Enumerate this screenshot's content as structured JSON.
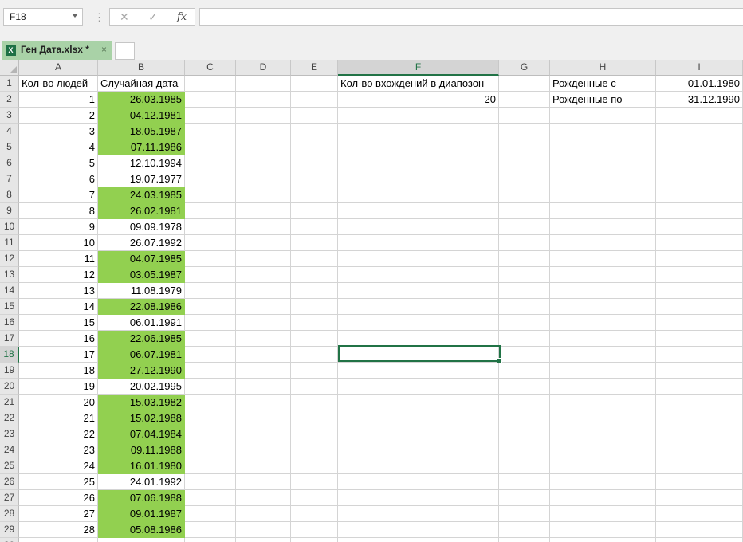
{
  "formula_bar": {
    "name_box": "F18",
    "cancel_icon": "✕",
    "enter_icon": "✓",
    "fx_label": "fx",
    "formula": ""
  },
  "tabs": [
    {
      "label": "Ген Дата.xlsx *",
      "close_icon": "×",
      "file_icon": "X"
    }
  ],
  "columns": [
    {
      "letter": "A",
      "width": 99
    },
    {
      "letter": "B",
      "width": 109
    },
    {
      "letter": "C",
      "width": 64
    },
    {
      "letter": "D",
      "width": 69
    },
    {
      "letter": "E",
      "width": 59
    },
    {
      "letter": "F",
      "width": 202
    },
    {
      "letter": "G",
      "width": 64
    },
    {
      "letter": "H",
      "width": 133
    },
    {
      "letter": "I",
      "width": 109
    }
  ],
  "selected": {
    "cell": "F18",
    "row": 18,
    "col": "F"
  },
  "header_row": {
    "A": "Кол-во людей",
    "B": "Случайная дата",
    "F": "Кол-во вхождений в диапозон",
    "H": "Рожденные с",
    "I": "01.01.1980"
  },
  "row2": {
    "F": "20",
    "H": "Рожденные по",
    "I": "31.12.1990"
  },
  "data_rows": [
    {
      "row": 2,
      "n": "1",
      "date": "26.03.1985",
      "in_range": true
    },
    {
      "row": 3,
      "n": "2",
      "date": "04.12.1981",
      "in_range": true
    },
    {
      "row": 4,
      "n": "3",
      "date": "18.05.1987",
      "in_range": true
    },
    {
      "row": 5,
      "n": "4",
      "date": "07.11.1986",
      "in_range": true
    },
    {
      "row": 6,
      "n": "5",
      "date": "12.10.1994",
      "in_range": false
    },
    {
      "row": 7,
      "n": "6",
      "date": "19.07.1977",
      "in_range": false
    },
    {
      "row": 8,
      "n": "7",
      "date": "24.03.1985",
      "in_range": true
    },
    {
      "row": 9,
      "n": "8",
      "date": "26.02.1981",
      "in_range": true
    },
    {
      "row": 10,
      "n": "9",
      "date": "09.09.1978",
      "in_range": false
    },
    {
      "row": 11,
      "n": "10",
      "date": "26.07.1992",
      "in_range": false
    },
    {
      "row": 12,
      "n": "11",
      "date": "04.07.1985",
      "in_range": true
    },
    {
      "row": 13,
      "n": "12",
      "date": "03.05.1987",
      "in_range": true
    },
    {
      "row": 14,
      "n": "13",
      "date": "11.08.1979",
      "in_range": false
    },
    {
      "row": 15,
      "n": "14",
      "date": "22.08.1986",
      "in_range": true
    },
    {
      "row": 16,
      "n": "15",
      "date": "06.01.1991",
      "in_range": false
    },
    {
      "row": 17,
      "n": "16",
      "date": "22.06.1985",
      "in_range": true
    },
    {
      "row": 18,
      "n": "17",
      "date": "06.07.1981",
      "in_range": true
    },
    {
      "row": 19,
      "n": "18",
      "date": "27.12.1990",
      "in_range": true
    },
    {
      "row": 20,
      "n": "19",
      "date": "20.02.1995",
      "in_range": false
    },
    {
      "row": 21,
      "n": "20",
      "date": "15.03.1982",
      "in_range": true
    },
    {
      "row": 22,
      "n": "21",
      "date": "15.02.1988",
      "in_range": true
    },
    {
      "row": 23,
      "n": "22",
      "date": "07.04.1984",
      "in_range": true
    },
    {
      "row": 24,
      "n": "23",
      "date": "09.11.1988",
      "in_range": true
    },
    {
      "row": 25,
      "n": "24",
      "date": "16.01.1980",
      "in_range": true
    },
    {
      "row": 26,
      "n": "25",
      "date": "24.01.1992",
      "in_range": false
    },
    {
      "row": 27,
      "n": "26",
      "date": "07.06.1988",
      "in_range": true
    },
    {
      "row": 28,
      "n": "27",
      "date": "09.01.1987",
      "in_range": true
    },
    {
      "row": 29,
      "n": "28",
      "date": "05.08.1986",
      "in_range": true
    }
  ],
  "colors": {
    "highlight": "#92d050",
    "selection": "#217346"
  }
}
